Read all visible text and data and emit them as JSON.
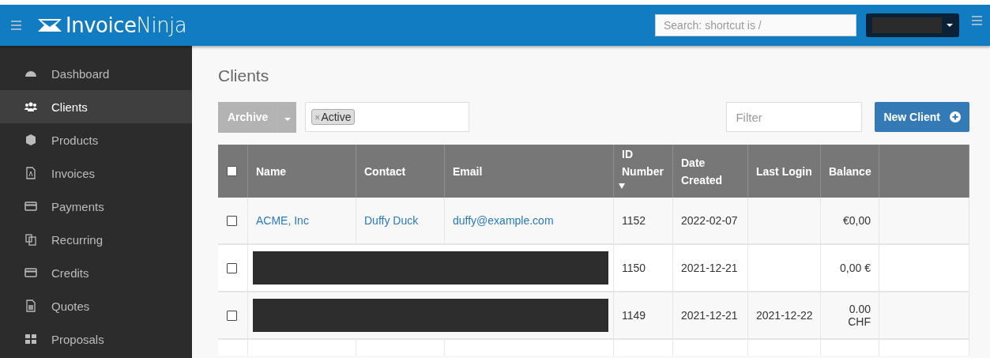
{
  "topbar": {
    "logo": "**Invoice**Ninja",
    "search": {
      "placeholder": "Search: shortcut is /"
    }
  },
  "sidebar": {
    "items": [
      {
        "label": "Dashboard",
        "selected": false
      },
      {
        "label": "Clients",
        "selected": true
      },
      {
        "label": "Products",
        "selected": false
      },
      {
        "label": "Invoices",
        "selected": false
      },
      {
        "label": "Payments",
        "selected": false
      },
      {
        "label": "Recurring",
        "selected": false
      },
      {
        "label": "Credits",
        "selected": false
      },
      {
        "label": "Quotes",
        "selected": false
      },
      {
        "label": "Proposals",
        "selected": false
      }
    ]
  },
  "page": {
    "title": "Clients"
  },
  "toolbar": {
    "archive_button": "Archive",
    "disabled": true,
    "status_tag": "Active",
    "tag_remove": "×",
    "filter": {
      "placeholder": "Filter"
    },
    "new_button": "New Client"
  },
  "table": {
    "select_all": {
      "checked": false
    },
    "columns": [
      {
        "label": "Name",
        "sorted": false
      },
      {
        "label": "Contact",
        "sorted": false
      },
      {
        "label": "Email",
        "sorted": false
      },
      {
        "label": "ID Number",
        "sorted": true
      },
      {
        "label": "Date Created",
        "sorted": false
      },
      {
        "label": "Last Login",
        "sorted": false
      },
      {
        "label": "Balance",
        "sorted": false
      }
    ],
    "rows": [
      {
        "checked": false,
        "redacted": false,
        "name": "ACME, Inc",
        "contact": "Duffy Duck",
        "email": "duffy@example.com",
        "id": "1152",
        "created": "2022-02-07",
        "balance": "€0,00"
      },
      {
        "checked": false,
        "redacted": true,
        "id": "1150",
        "created": "2021-12-21",
        "balance": "0,00 €"
      },
      {
        "checked": false,
        "redacted": true,
        "id": "1149",
        "created": "2021-12-21",
        "last_login": "2021-12-22",
        "balance": "0.00 CHF"
      }
    ]
  }
}
